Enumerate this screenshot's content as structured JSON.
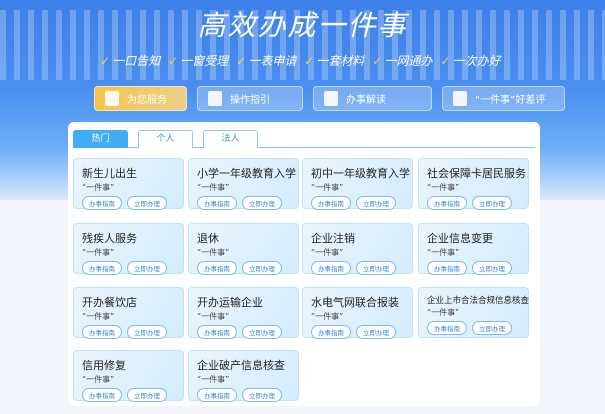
{
  "header": {
    "title": "高效办成一件事",
    "slogans": [
      "一口告知",
      "一窗受理",
      "一表申请",
      "一套材料",
      "一网通办",
      "一次办好"
    ]
  },
  "nav": [
    {
      "label": "为您服务",
      "icon": "book-icon",
      "active": true
    },
    {
      "label": "操作指引",
      "icon": "video-icon"
    },
    {
      "label": "办事解读",
      "icon": "document-icon"
    },
    {
      "label": "“一件事”好差评",
      "icon": "review-icon"
    }
  ],
  "tabs": [
    {
      "label": "热门",
      "active": true
    },
    {
      "label": "个人"
    },
    {
      "label": "法人"
    }
  ],
  "card_subtitle": "“一件事”",
  "card_buttons": {
    "guide": "办事指南",
    "apply": "立即办理"
  },
  "cards": [
    {
      "title": "新生儿出生"
    },
    {
      "title": "小学一年级教育入学"
    },
    {
      "title": "初中一年级教育入学"
    },
    {
      "title": "社会保障卡居民服务"
    },
    {
      "title": "残疾人服务"
    },
    {
      "title": "退休"
    },
    {
      "title": "企业注销"
    },
    {
      "title": "企业信息变更"
    },
    {
      "title": "开办餐饮店"
    },
    {
      "title": "开办运输企业"
    },
    {
      "title": "水电气网联合报装"
    },
    {
      "title": "企业上市合法合规信息核查"
    },
    {
      "title": "信用修复"
    },
    {
      "title": "企业破产信息核查"
    }
  ],
  "colors": {
    "accent": "#41adf7",
    "gold": "#f6c44a"
  }
}
